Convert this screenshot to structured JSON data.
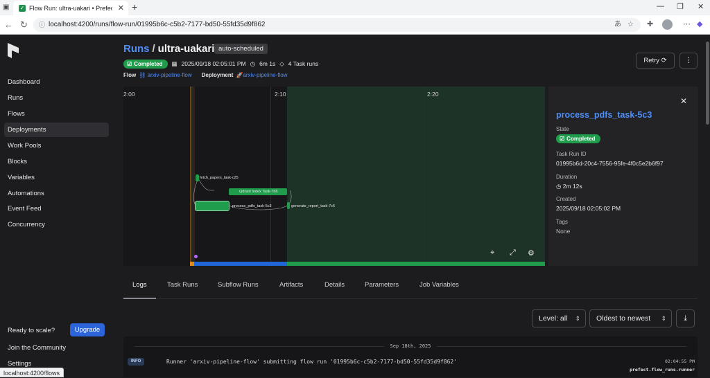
{
  "browser": {
    "tab_title": "Flow Run: ultra-uakari • Prefect Se",
    "url": "localhost:4200/runs/flow-run/01995b6c-c5b2-7177-bd50-55fd35d9f862",
    "status_url": "localhost:4200/flows"
  },
  "sidebar": {
    "items": [
      {
        "label": "Dashboard"
      },
      {
        "label": "Runs"
      },
      {
        "label": "Flows"
      },
      {
        "label": "Deployments"
      },
      {
        "label": "Work Pools"
      },
      {
        "label": "Blocks"
      },
      {
        "label": "Variables"
      },
      {
        "label": "Automations"
      },
      {
        "label": "Event Feed"
      },
      {
        "label": "Concurrency"
      }
    ],
    "active_index": 3,
    "ready_text": "Ready to scale?",
    "upgrade_label": "Upgrade",
    "join_label": "Join the Community",
    "settings_label": "Settings"
  },
  "header": {
    "runs_label": "Runs",
    "separator": "/",
    "run_name": "ultra-uakari",
    "tag": "auto-scheduled",
    "state": "Completed",
    "start_time": "2025/09/18 02:05:01 PM",
    "duration": "6m 1s",
    "task_runs": "4 Task runs",
    "flow_label": "Flow",
    "flow_name": "arxiv-pipeline-flow",
    "deployment_label": "Deployment",
    "deployment_name": "arxiv-pipeline-flow",
    "retry_label": "Retry"
  },
  "timeline": {
    "ticks": [
      "2:00",
      "2:10",
      "2:20"
    ],
    "tasks": [
      {
        "name": "fetch_papers_task-c25"
      },
      {
        "name": "Qdrant Index Task-766"
      },
      {
        "name": "process_pdfs_task-5c3"
      },
      {
        "name": "generate_report_task-7c6"
      }
    ]
  },
  "panel": {
    "title": "process_pdfs_task-5c3",
    "state_label": "State",
    "state": "Completed",
    "task_run_id_label": "Task Run ID",
    "task_run_id": "01995b6d-20c4-7556-95fe-4f0c5e2b6f97",
    "duration_label": "Duration",
    "duration": "2m 12s",
    "created_label": "Created",
    "created": "2025/09/18 02:05:02 PM",
    "tags_label": "Tags",
    "tags": "None"
  },
  "tabs": [
    "Logs",
    "Task Runs",
    "Subflow Runs",
    "Artifacts",
    "Details",
    "Parameters",
    "Job Variables"
  ],
  "logs": {
    "level_filter": "Level: all",
    "order": "Oldest to newest",
    "date_divider": "Sep 18th, 2025",
    "entries": [
      {
        "level": "INFO",
        "message": "Runner 'arxiv-pipeline-flow' submitting flow run '01995b6c-c5b2-7177-bd50-55fd35d9f862'",
        "time": "02:04:55 PM",
        "logger": "prefect.flow_runs.runner"
      }
    ]
  },
  "colors": {
    "accent": "#4e8ef7",
    "success": "#1f9d4d",
    "upgrade": "#2b65d9"
  }
}
